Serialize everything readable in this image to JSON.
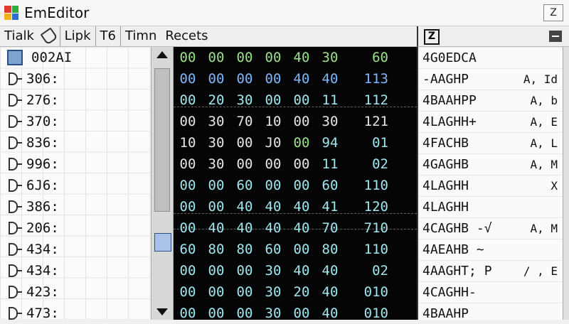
{
  "window": {
    "title": "EmEditor",
    "corner_button": "Z"
  },
  "menu": {
    "items": [
      "Tialk",
      "Lipk",
      "T6",
      "Timn",
      "Recets"
    ]
  },
  "left_list": {
    "items": [
      {
        "label": "002AI",
        "icon": "square-icon"
      },
      {
        "label": "306:",
        "icon": "doc-icon"
      },
      {
        "label": "276:",
        "icon": "doc-icon"
      },
      {
        "label": "370:",
        "icon": "doc-icon"
      },
      {
        "label": "836:",
        "icon": "doc-icon"
      },
      {
        "label": "996:",
        "icon": "doc-icon"
      },
      {
        "label": "6J6:",
        "icon": "doc-icon"
      },
      {
        "label": "386:",
        "icon": "doc-icon"
      },
      {
        "label": "206:",
        "icon": "doc-icon"
      },
      {
        "label": "434:",
        "icon": "doc-icon"
      },
      {
        "label": "434:",
        "icon": "doc-icon"
      },
      {
        "label": "423:",
        "icon": "doc-icon"
      },
      {
        "label": "473:",
        "icon": "doc-icon"
      }
    ]
  },
  "hex": {
    "rows": [
      [
        "00",
        "00",
        "00",
        "00",
        "40",
        "30",
        "60"
      ],
      [
        "00",
        "00",
        "00",
        "00",
        "40",
        "40",
        "113"
      ],
      [
        "00",
        "20",
        "30",
        "00",
        "00",
        "11",
        "112"
      ],
      [
        "00",
        "30",
        "70",
        "10",
        "00",
        "30",
        "121"
      ],
      [
        "10",
        "30",
        "00",
        "J0",
        "00",
        "94",
        "01"
      ],
      [
        "00",
        "30",
        "00",
        "00",
        "00",
        "11",
        "02"
      ],
      [
        "00",
        "00",
        "60",
        "00",
        "00",
        "60",
        "110"
      ],
      [
        "00",
        "00",
        "40",
        "40",
        "40",
        "41",
        "120"
      ],
      [
        "00",
        "40",
        "40",
        "40",
        "40",
        "70",
        "710"
      ],
      [
        "60",
        "80",
        "80",
        "60",
        "00",
        "80",
        "110"
      ],
      [
        "00",
        "00",
        "00",
        "30",
        "40",
        "40",
        "02"
      ],
      [
        "00",
        "00",
        "00",
        "30",
        "20",
        "40",
        "010"
      ],
      [
        "00",
        "00",
        "00",
        "30",
        "00",
        "40",
        "010"
      ]
    ]
  },
  "ascii": {
    "header_icon": "Z",
    "rows": [
      {
        "text": "4G0EDCA",
        "extra": ""
      },
      {
        "text": "-AAGHP",
        "extra": "A, Id"
      },
      {
        "text": "4BAAHPP",
        "extra": "A, b"
      },
      {
        "text": "4LAGHH+",
        "extra": "A, E"
      },
      {
        "text": "4FACHB",
        "extra": "A, L"
      },
      {
        "text": "4GAGHB",
        "extra": "A, M"
      },
      {
        "text": "4LAGHH",
        "extra": "X"
      },
      {
        "text": "4LAGHH",
        "extra": ""
      },
      {
        "text": "4CAGHB -√",
        "extra": "A, M"
      },
      {
        "text": "4AEAHB ~",
        "extra": ""
      },
      {
        "text": "4AAGHT; P",
        "extra": "/ , E"
      },
      {
        "text": "4CAGHH-",
        "extra": ""
      },
      {
        "text": "4BAAHP",
        "extra": ""
      }
    ]
  },
  "colors": {
    "hex_bg": "#050505",
    "green": "#9be38b",
    "cyan": "#9ee7f0",
    "blue": "#7fb8ff"
  }
}
